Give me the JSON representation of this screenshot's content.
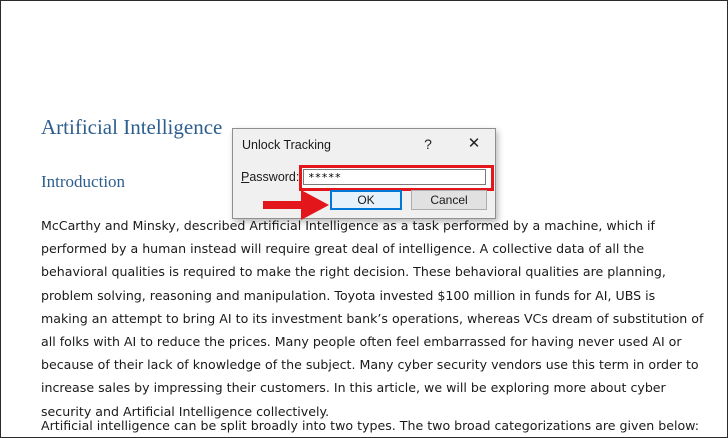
{
  "document": {
    "title": "Artificial Intelligence",
    "heading": "Introduction",
    "paragraph1_lines": [
      "McCarthy and Minsky, described Artificial Intelligence as a task performed by a machine, which if",
      "performed by a human instead will require great deal of intelligence. A collective data of all the",
      "behavioral qualities is required to make the right decision. These behavioral qualities are planning,",
      "problem solving, reasoning and manipulation. Toyota invested $100 million in funds for AI, UBS is",
      "making an attempt to bring AI to its investment bank’s operations, whereas VCs dream of substitution of",
      "all folks with AI to reduce the prices. Many people often feel embarrassed for having never used AI or",
      "because of their lack of knowledge of the subject. Many cyber security vendors use this term in order to",
      "increase sales by impressing their customers. In this article, we will be exploring more about cyber",
      "security and Artificial Intelligence collectively."
    ],
    "paragraph2_lines": [
      "Artificial intelligence can be split broadly into two types. The two broad categorizations are given below:"
    ]
  },
  "dialog": {
    "title": "Unlock Tracking",
    "help_glyph": "?",
    "close_glyph": "✕",
    "password_label_accel": "P",
    "password_label_rest": "assword:",
    "password_value": "*****",
    "ok_label": "OK",
    "cancel_label": "Cancel"
  },
  "annotation": {
    "arrow_color": "#e3161c",
    "highlight_color": "#e3161c"
  },
  "colors": {
    "heading": "#2e5e8e",
    "ok_focus_border": "#0078d7"
  }
}
